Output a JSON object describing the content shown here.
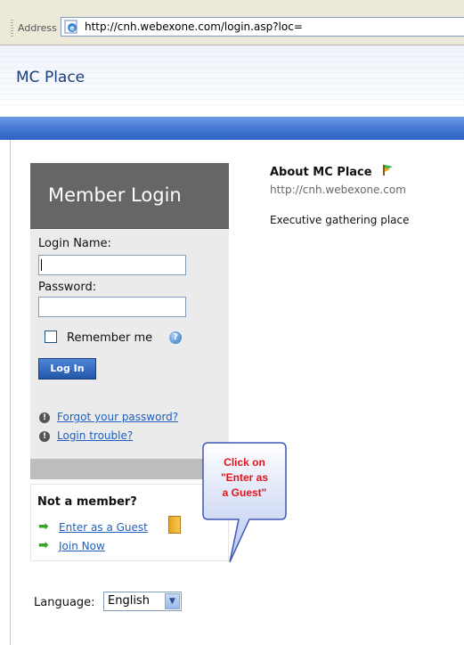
{
  "address_bar": {
    "label": "Address",
    "url": "http://cnh.webexone.com/login.asp?loc="
  },
  "site": {
    "title": "MC Place"
  },
  "login": {
    "header": "Member Login",
    "login_name_label": "Login Name:",
    "login_name_value": "",
    "password_label": "Password:",
    "password_value": "",
    "remember_label": "Remember me",
    "remember_checked": false,
    "login_button": "Log In",
    "forgot_link": "Forgot your password?",
    "trouble_link": "Login trouble?"
  },
  "member": {
    "title": "Not a member?",
    "guest_link": "Enter as a Guest",
    "join_link": "Join Now"
  },
  "callout": {
    "text": "Click on \"Enter as a Guest\"",
    "line1": "Click on",
    "line2": "\"Enter as",
    "line3": "a Guest\"",
    "color": "#e0141c"
  },
  "language": {
    "label": "Language:",
    "selected": "English"
  },
  "about": {
    "title": "About MC Place",
    "url": "http://cnh.webexone.com",
    "description": "Executive gathering place"
  },
  "colors": {
    "band": "#3f74d0",
    "login_header": "#666666",
    "link": "#1f5fbf"
  }
}
